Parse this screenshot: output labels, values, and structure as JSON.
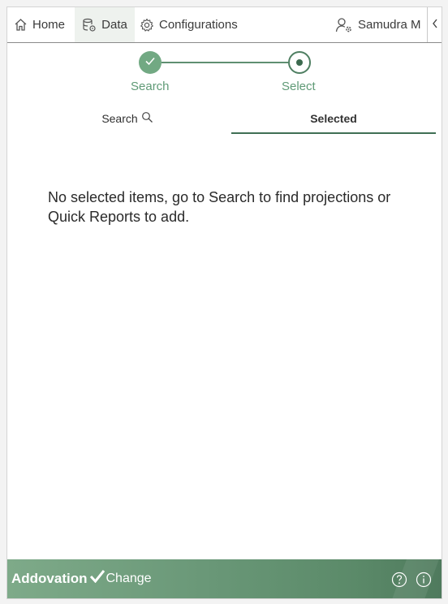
{
  "nav": {
    "home_label": "Home",
    "data_label": "Data",
    "config_label": "Configurations",
    "user_name": "Samudra M",
    "icons": {
      "home": "home-icon",
      "data": "database-icon",
      "config": "gear-icon",
      "user": "user-settings-icon",
      "collapse": "chevron-left-icon"
    }
  },
  "stepper": {
    "steps": [
      {
        "label": "Search",
        "state": "complete"
      },
      {
        "label": "Select",
        "state": "current"
      }
    ]
  },
  "tabs": {
    "search_label": "Search",
    "selected_label": "Selected",
    "active": "Selected"
  },
  "main": {
    "empty_message": "No selected items, go to Search to find projections or Quick Reports to add."
  },
  "footer": {
    "brand_main": "Addovation",
    "brand_sub": "Change",
    "icons": [
      "help-icon",
      "info-icon"
    ]
  },
  "colors": {
    "accent": "#3f6f54",
    "step_complete": "#72a983",
    "step_label": "#5f9a76",
    "footer_start": "#7eaa89",
    "footer_end": "#4f7a5d"
  }
}
